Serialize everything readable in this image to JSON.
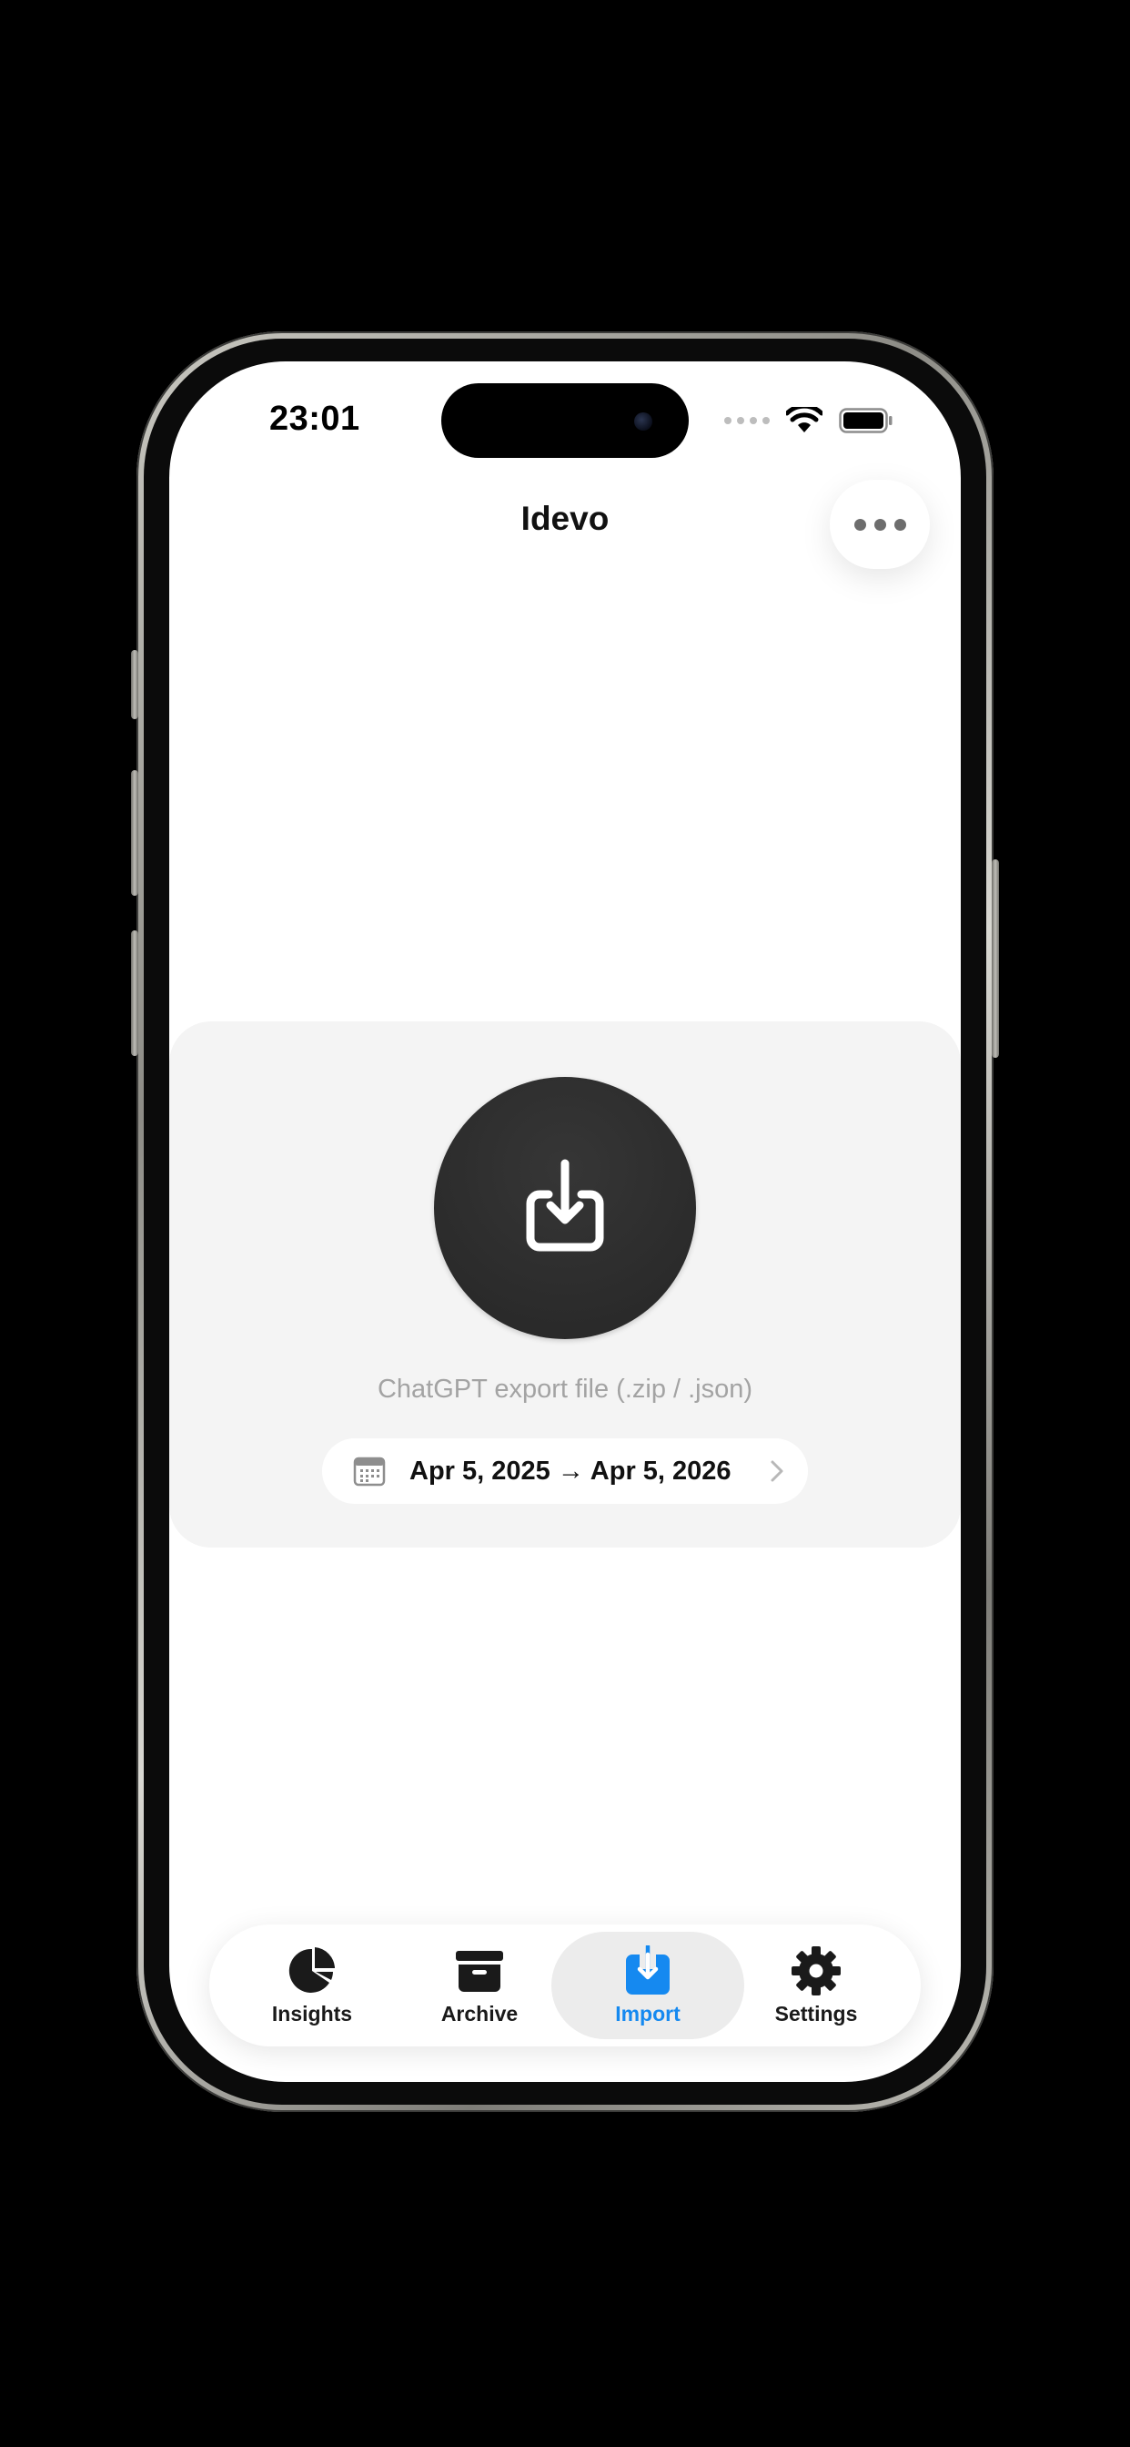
{
  "status_bar": {
    "time": "23:01",
    "icons": [
      "cellular-signal-icon",
      "wifi-icon",
      "battery-icon"
    ]
  },
  "header": {
    "title": "Idevo",
    "more_icon": "ellipsis-icon"
  },
  "import_card": {
    "icon": "tray-arrow-down-icon",
    "hint": "ChatGPT export file (.zip / .json)",
    "date_range": {
      "icon": "calendar-icon",
      "label": "Apr 5, 2025 → Apr 5, 2026",
      "chevron_icon": "chevron-right-icon"
    }
  },
  "tab_bar": {
    "tabs": [
      {
        "label": "Insights",
        "icon": "pie-chart-icon",
        "active": false
      },
      {
        "label": "Archive",
        "icon": "archive-box-icon",
        "active": false
      },
      {
        "label": "Import",
        "icon": "tray-arrow-down-icon",
        "active": true
      },
      {
        "label": "Settings",
        "icon": "gear-icon",
        "active": false
      }
    ]
  },
  "colors": {
    "accent": "#1589f0",
    "card_background": "#f4f4f4",
    "import_circle": "#2e2e2e",
    "hint_text": "#a3a3a3",
    "active_tab_background": "#ececec"
  }
}
